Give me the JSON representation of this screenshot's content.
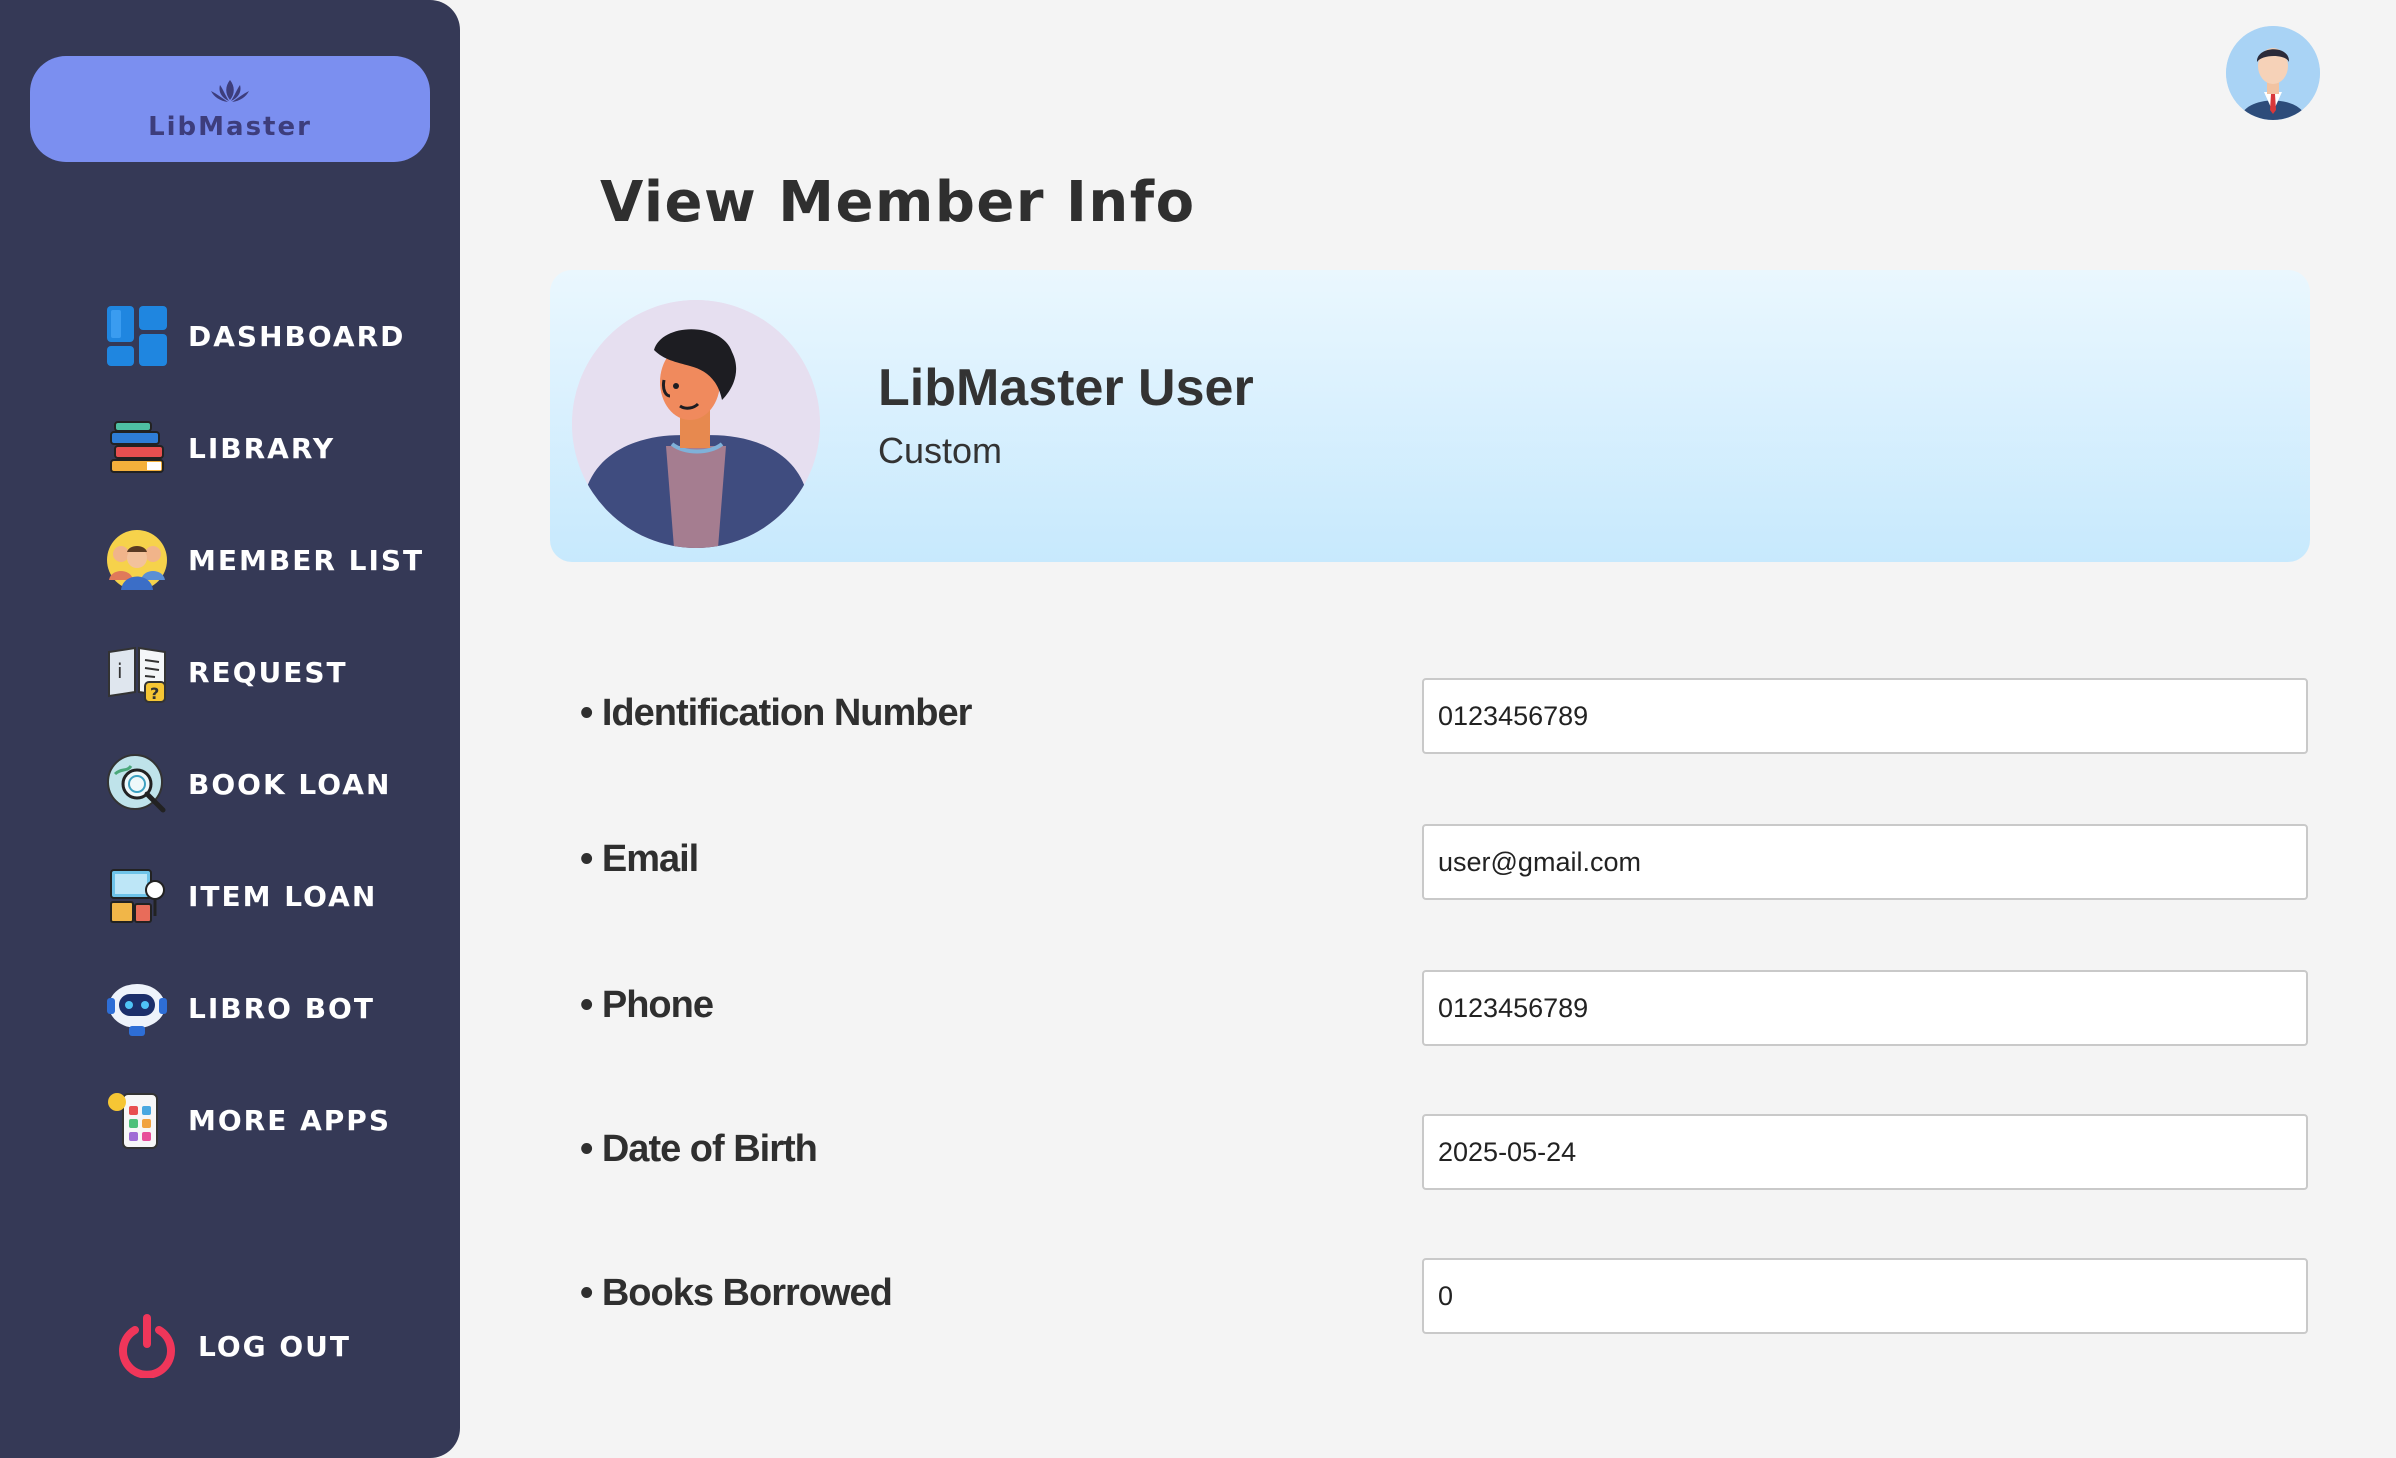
{
  "brand": {
    "name": "LibMaster",
    "icon": "lotus-logo-icon"
  },
  "sidebar": {
    "items": [
      {
        "label": "DASHBOARD",
        "icon": "dashboard-icon"
      },
      {
        "label": "LIBRARY",
        "icon": "books-icon"
      },
      {
        "label": "MEMBER LIST",
        "icon": "members-icon"
      },
      {
        "label": "REQUEST",
        "icon": "request-icon"
      },
      {
        "label": "BOOK LOAN",
        "icon": "book-loan-icon"
      },
      {
        "label": "ITEM LOAN",
        "icon": "item-loan-icon"
      },
      {
        "label": "LIBRO BOT",
        "icon": "robot-icon"
      },
      {
        "label": "MORE APPS",
        "icon": "apps-icon"
      }
    ],
    "logout": {
      "label": "LOG OUT",
      "icon": "power-icon"
    }
  },
  "header": {
    "avatar_icon": "user-avatar-icon"
  },
  "main": {
    "title": "View Member Info",
    "profile": {
      "name": "LibMaster User",
      "role": "Custom"
    },
    "fields": [
      {
        "label": "• Identification Number",
        "value": "0123456789"
      },
      {
        "label": "• Email",
        "value": "user@gmail.com"
      },
      {
        "label": "• Phone",
        "value": "0123456789"
      },
      {
        "label": "• Date of Birth",
        "value": "2025-05-24"
      },
      {
        "label": "• Books Borrowed",
        "value": "0"
      }
    ]
  },
  "colors": {
    "sidebar_bg": "#353956",
    "brand_bg": "#7b8ff0",
    "page_bg": "#f4f4f4",
    "card_gradient_top": "#eaf7fe",
    "card_gradient_bottom": "#c7e9fd"
  }
}
